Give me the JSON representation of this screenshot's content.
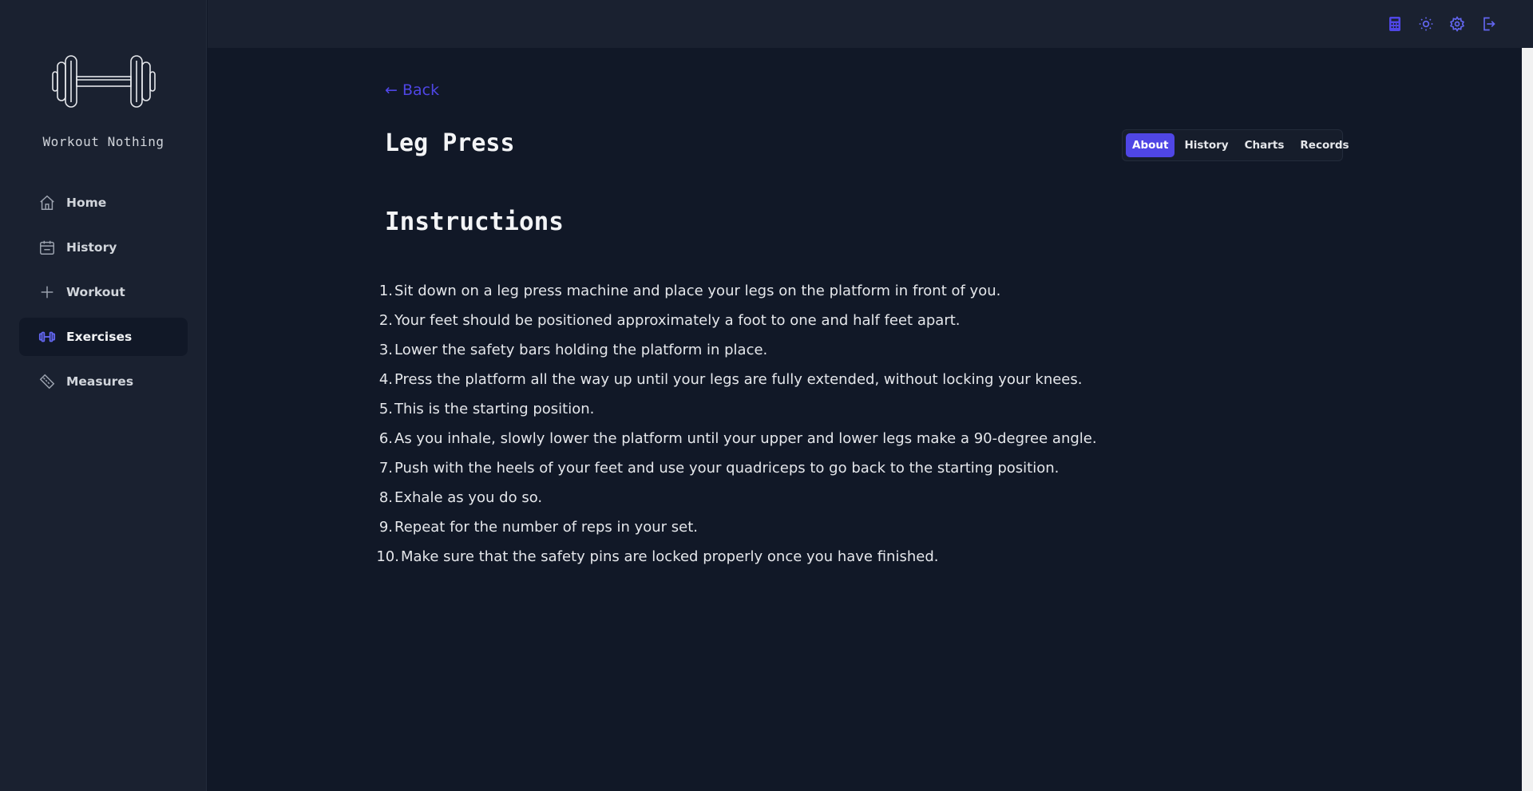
{
  "app": {
    "name": "Workout Nothing"
  },
  "sidebar": {
    "items": [
      {
        "label": "Home",
        "icon": "home-icon"
      },
      {
        "label": "History",
        "icon": "calendar-icon"
      },
      {
        "label": "Workout",
        "icon": "plus-icon"
      },
      {
        "label": "Exercises",
        "icon": "dumbbell-icon",
        "active": true
      },
      {
        "label": "Measures",
        "icon": "ruler-icon"
      }
    ]
  },
  "topbar": {
    "icons": [
      "calculator-icon",
      "sun-icon",
      "gear-icon",
      "logout-icon"
    ],
    "accent": "#4f46e5"
  },
  "page": {
    "back_label": "← Back",
    "title": "Leg Press",
    "tabs": [
      {
        "label": "About",
        "active": true
      },
      {
        "label": "History"
      },
      {
        "label": "Charts"
      },
      {
        "label": "Records"
      }
    ],
    "section_title": "Instructions",
    "instructions": [
      {
        "num": "1.",
        "text": "Sit down on a leg press machine and place your legs on the platform in front of you."
      },
      {
        "num": "2.",
        "text": "Your feet should be positioned approximately a foot to one and half feet apart."
      },
      {
        "num": "3.",
        "text": "Lower the safety bars holding the platform in place."
      },
      {
        "num": "4.",
        "text": "Press the platform all the way up until your legs are fully extended, without locking your knees."
      },
      {
        "num": "5.",
        "text": "This is the starting position."
      },
      {
        "num": "6.",
        "text": "As you inhale, slowly lower the platform until your upper and lower legs make a 90-degree angle."
      },
      {
        "num": "7.",
        "text": "Push with the heels of your feet and use your quadriceps to go back to the starting position."
      },
      {
        "num": "8.",
        "text": "Exhale as you do so."
      },
      {
        "num": "9.",
        "text": "Repeat for the number of reps in your set."
      },
      {
        "num": "10.",
        "text": "Make sure that the safety pins are locked properly once you have finished."
      }
    ]
  }
}
